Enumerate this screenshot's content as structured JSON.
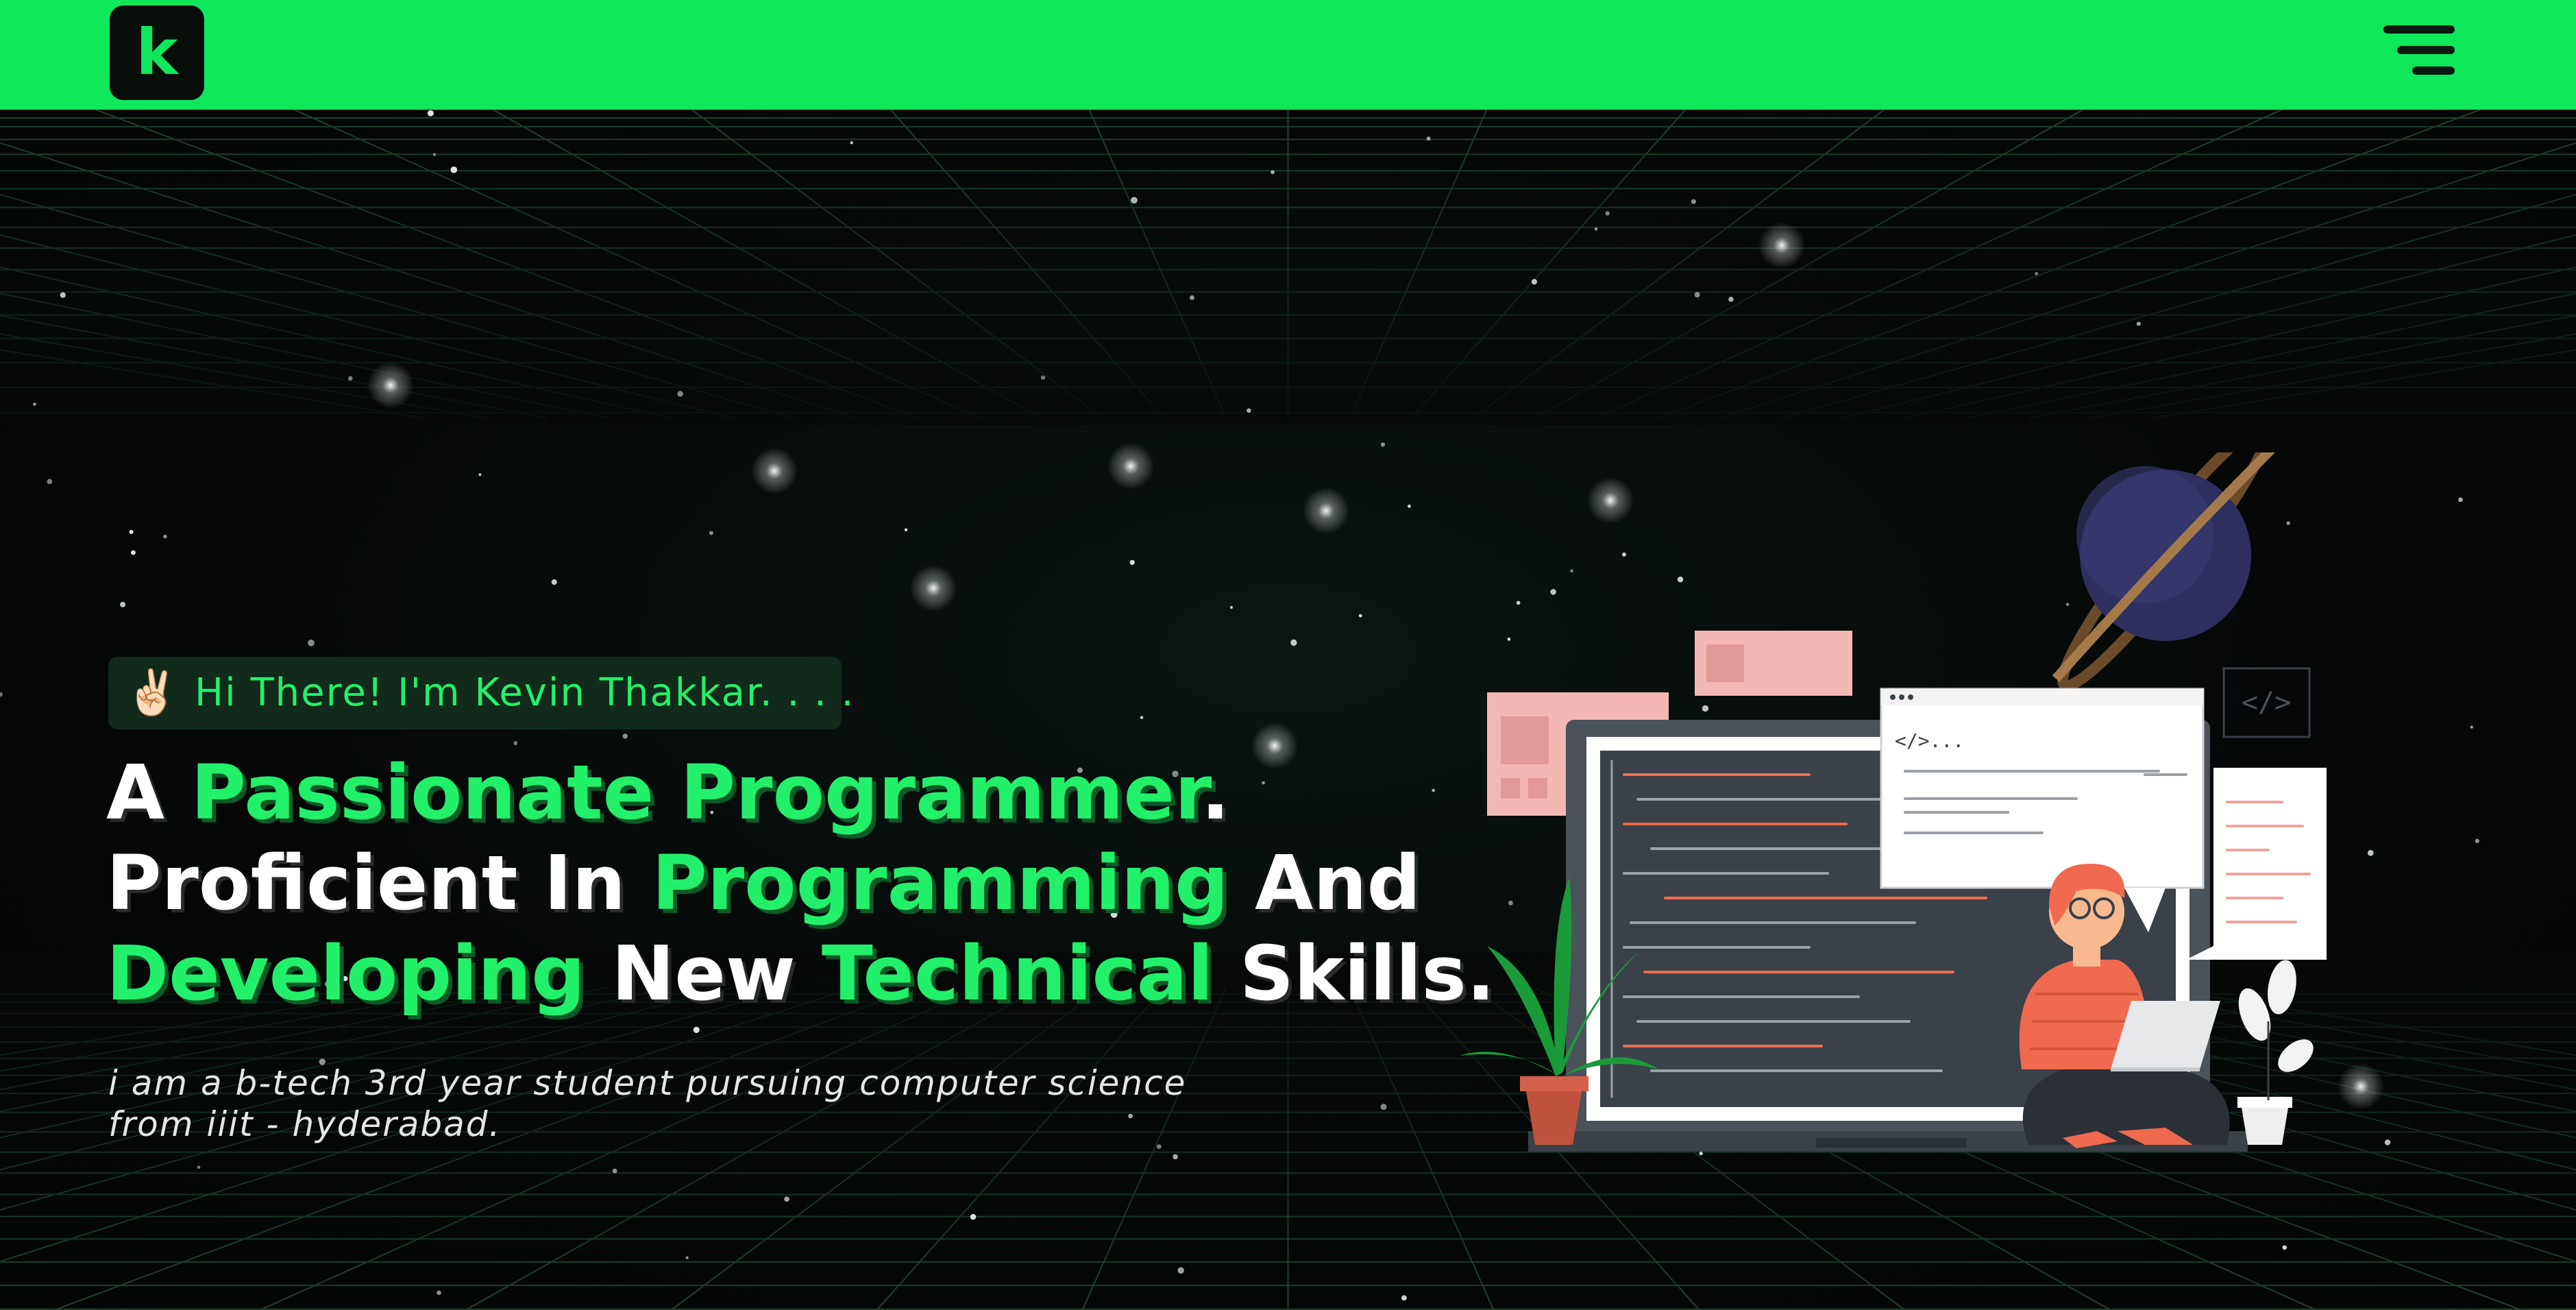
{
  "nav": {
    "logo_letter": "k",
    "menu_icon": "hamburger-menu-icon",
    "brand_color": "#0fe85b"
  },
  "hero": {
    "greeting_emoji": "✌🏻",
    "greeting": "Hi There! I'm Kevin Thakkar. . . .",
    "headline": {
      "line1": [
        "A",
        "Passionate Programmer",
        "."
      ],
      "line2": [
        "Proficient In",
        "Programming",
        "And"
      ],
      "line3": [
        "Developing",
        "New",
        "Technical",
        "Skills."
      ]
    },
    "description": "i am a b-tech 3rd year student pursuing computer science from iiit - hyderabad.",
    "illustration": {
      "window_code_label": "</>...",
      "code_tag_label": "</>"
    }
  },
  "colors": {
    "accent": "#22f06a",
    "background": "#050807",
    "text": "#ffffff"
  }
}
